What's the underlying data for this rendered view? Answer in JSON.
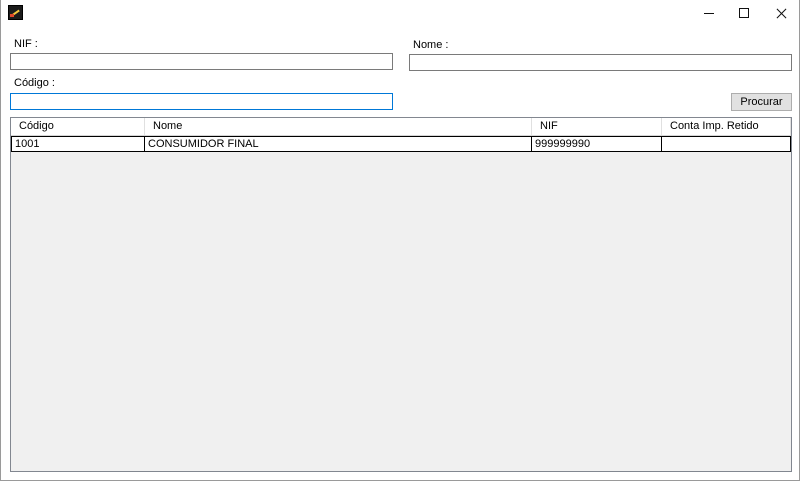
{
  "window": {
    "title": "",
    "icon": "app-icon",
    "controls": [
      "minimize-icon",
      "maximize-icon",
      "close-icon"
    ]
  },
  "form": {
    "nif_label": "NIF :",
    "nif_value": "",
    "nome_label": "Nome :",
    "nome_value": "",
    "codigo_label": "Código :",
    "codigo_value": "",
    "search_button": "Procurar"
  },
  "grid": {
    "columns": [
      "Código",
      "Nome",
      "NIF",
      "Conta Imp. Retido"
    ],
    "rows": [
      [
        "1001",
        "CONSUMIDOR FINAL",
        "999999990",
        ""
      ]
    ]
  },
  "colors": {
    "focus_border": "#0078d7",
    "grid_background": "#f0f0f0",
    "button_face": "#e1e1e1"
  }
}
